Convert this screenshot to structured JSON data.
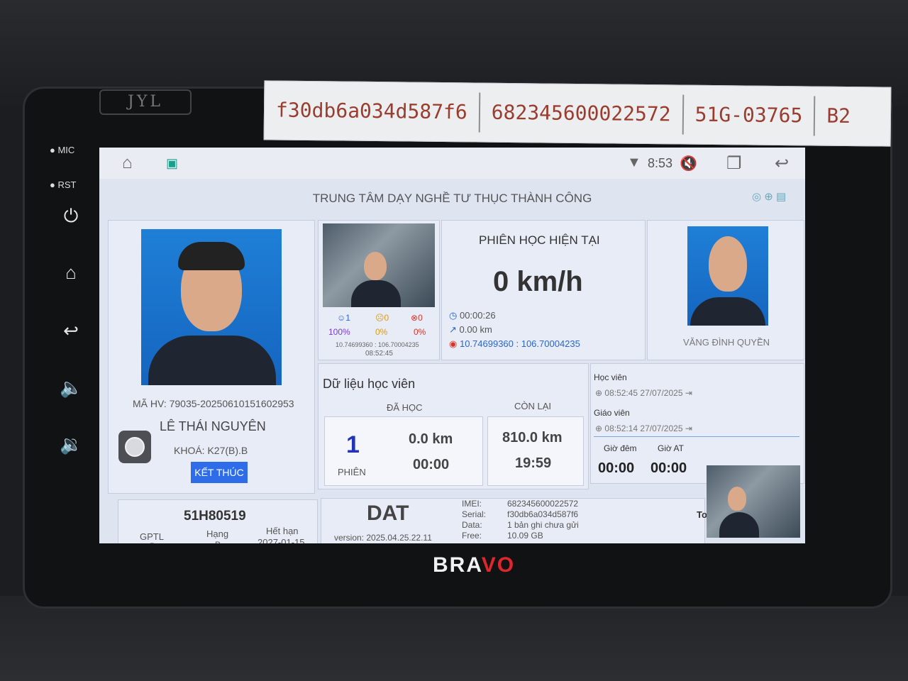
{
  "label_strip": [
    "f30db6a034d587f6",
    "682345600022572",
    "51G-03765",
    "B2"
  ],
  "device": {
    "brand_top": "JYL",
    "brand_bottom_left": "BRA",
    "brand_bottom_right": "VO",
    "mic_label": "MIC",
    "rst_label": "RST"
  },
  "status_bar": {
    "time": "8:53"
  },
  "header": {
    "title": "TRUNG TÂM DẠY NGHỀ TƯ THỤC THÀNH CÔNG"
  },
  "student": {
    "ma_hv": "MÃ HV: 79035-20250610151602953",
    "name": "LÊ THÁI NGUYÊN",
    "khoa": "KHOÁ: K27(B).B",
    "end_button": "KẾT THÚC"
  },
  "camera_stats": {
    "face_count": "1",
    "face_pct": "100%",
    "warn_count": "0",
    "warn_pct": "0%",
    "err_count": "0",
    "err_pct": "0%",
    "coords": "10.74699360 : 106.70004235",
    "time": "08:52:45"
  },
  "session": {
    "title": "PHIÊN HỌC HIỆN TẠI",
    "speed": "0 km/h",
    "duration": "00:00:26",
    "distance": "0.00 km",
    "coords": "10.74699360 : 106.70004235"
  },
  "teacher": {
    "name": "VĂNG ĐÌNH QUYỀN"
  },
  "student_data": {
    "title": "Dữ liệu học viên",
    "learned_label": "ĐÃ HỌC",
    "remaining_label": "CÒN LẠI",
    "sessions": "1",
    "sessions_label": "PHIÊN",
    "learned_km": "0.0 km",
    "learned_time": "00:00",
    "remaining_km": "810.0 km",
    "remaining_time": "19:59"
  },
  "login": {
    "student_label": "Học viên",
    "student_time": "08:52:45 27/07/2025",
    "teacher_label": "Giáo viên",
    "teacher_time": "08:52:14 27/07/2025",
    "night_label": "Giờ đêm",
    "at_label": "Giờ AT",
    "night_value": "00:00",
    "at_value": "00:00",
    "overlay_text": "To"
  },
  "vehicle": {
    "plate": "51H80519",
    "gptl_label": "GPTL",
    "gptl_value": "B",
    "hang_label": "Hạng",
    "hang_value": "B",
    "expire_label": "Hết hạn",
    "expire_value": "2027-01-15"
  },
  "device_info": {
    "app": "DAT",
    "version": "version: 2025.04.25.22.11",
    "imei_label": "IMEI:",
    "imei": "682345600022572",
    "serial_label": "Serial:",
    "serial": "f30db6a034d587f6",
    "data_label": "Data:",
    "data": "1 bản ghi chưa gửi",
    "free_label": "Free:",
    "free": "10.09 GB"
  }
}
